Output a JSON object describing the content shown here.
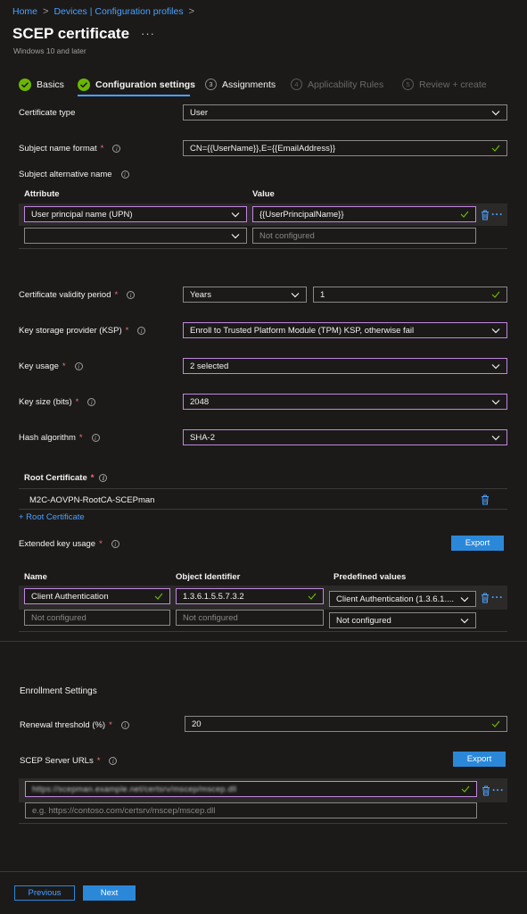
{
  "breadcrumb": {
    "home": "Home",
    "profiles": "Devices | Configuration profiles",
    "sep": ">"
  },
  "header": {
    "title": "SCEP certificate",
    "more": "···",
    "subtitle": "Windows 10 and later"
  },
  "steps": [
    {
      "label": "Basics",
      "state": "done"
    },
    {
      "label": "Configuration settings",
      "state": "active"
    },
    {
      "num": "3",
      "label": "Assignments",
      "state": "next"
    },
    {
      "num": "4",
      "label": "Applicability Rules",
      "state": "disabled"
    },
    {
      "num": "5",
      "label": "Review + create",
      "state": "disabled"
    }
  ],
  "form": {
    "certificate_type": {
      "label": "Certificate type",
      "value": "User"
    },
    "subject_name_format": {
      "label": "Subject name format",
      "value": "CN={{UserName}},E={{EmailAddress}}"
    },
    "san": {
      "label": "Subject alternative name",
      "col_attribute": "Attribute",
      "col_value": "Value",
      "row1_attribute": "User principal name (UPN)",
      "row1_value": "{{UserPrincipalName}}",
      "row2_value_placeholder": "Not configured"
    },
    "validity": {
      "label": "Certificate validity period",
      "unit": "Years",
      "value": "1"
    },
    "ksp": {
      "label": "Key storage provider (KSP)",
      "value": "Enroll to Trusted Platform Module (TPM) KSP, otherwise fail"
    },
    "key_usage": {
      "label": "Key usage",
      "value": "2 selected"
    },
    "key_size": {
      "label": "Key size (bits)",
      "value": "2048"
    },
    "hash": {
      "label": "Hash algorithm",
      "value": "SHA-2"
    },
    "root_cert": {
      "label": "Root Certificate",
      "value": "M2C-AOVPN-RootCA-SCEPman",
      "add_link": "+ Root Certificate"
    },
    "eku": {
      "label": "Extended key usage",
      "export": "Export",
      "col_name": "Name",
      "col_oid": "Object Identifier",
      "col_predef": "Predefined values",
      "row1_name": "Client Authentication",
      "row1_oid": "1.3.6.1.5.5.7.3.2",
      "row1_predef": "Client Authentication (1.3.6.1....",
      "row2_name_placeholder": "Not configured",
      "row2_oid_placeholder": "Not configured",
      "row2_predef": "Not configured"
    }
  },
  "enrollment": {
    "heading": "Enrollment Settings",
    "renewal": {
      "label": "Renewal threshold (%)",
      "value": "20"
    },
    "scep_urls": {
      "label": "SCEP Server URLs",
      "export": "Export",
      "row1_value": "https://scepman.example.net/certsrv/mscep/mscep.dll",
      "row2_placeholder": "e.g. https://contoso.com/certsrv/mscep/mscep.dll"
    }
  },
  "footer": {
    "previous": "Previous",
    "next": "Next"
  },
  "colors": {
    "accent": "#2b88d8",
    "link": "#4ba0ff",
    "focus": "#c286e0",
    "success": "#6bb700",
    "required": "#f1707b",
    "background": "#1b1a19"
  }
}
